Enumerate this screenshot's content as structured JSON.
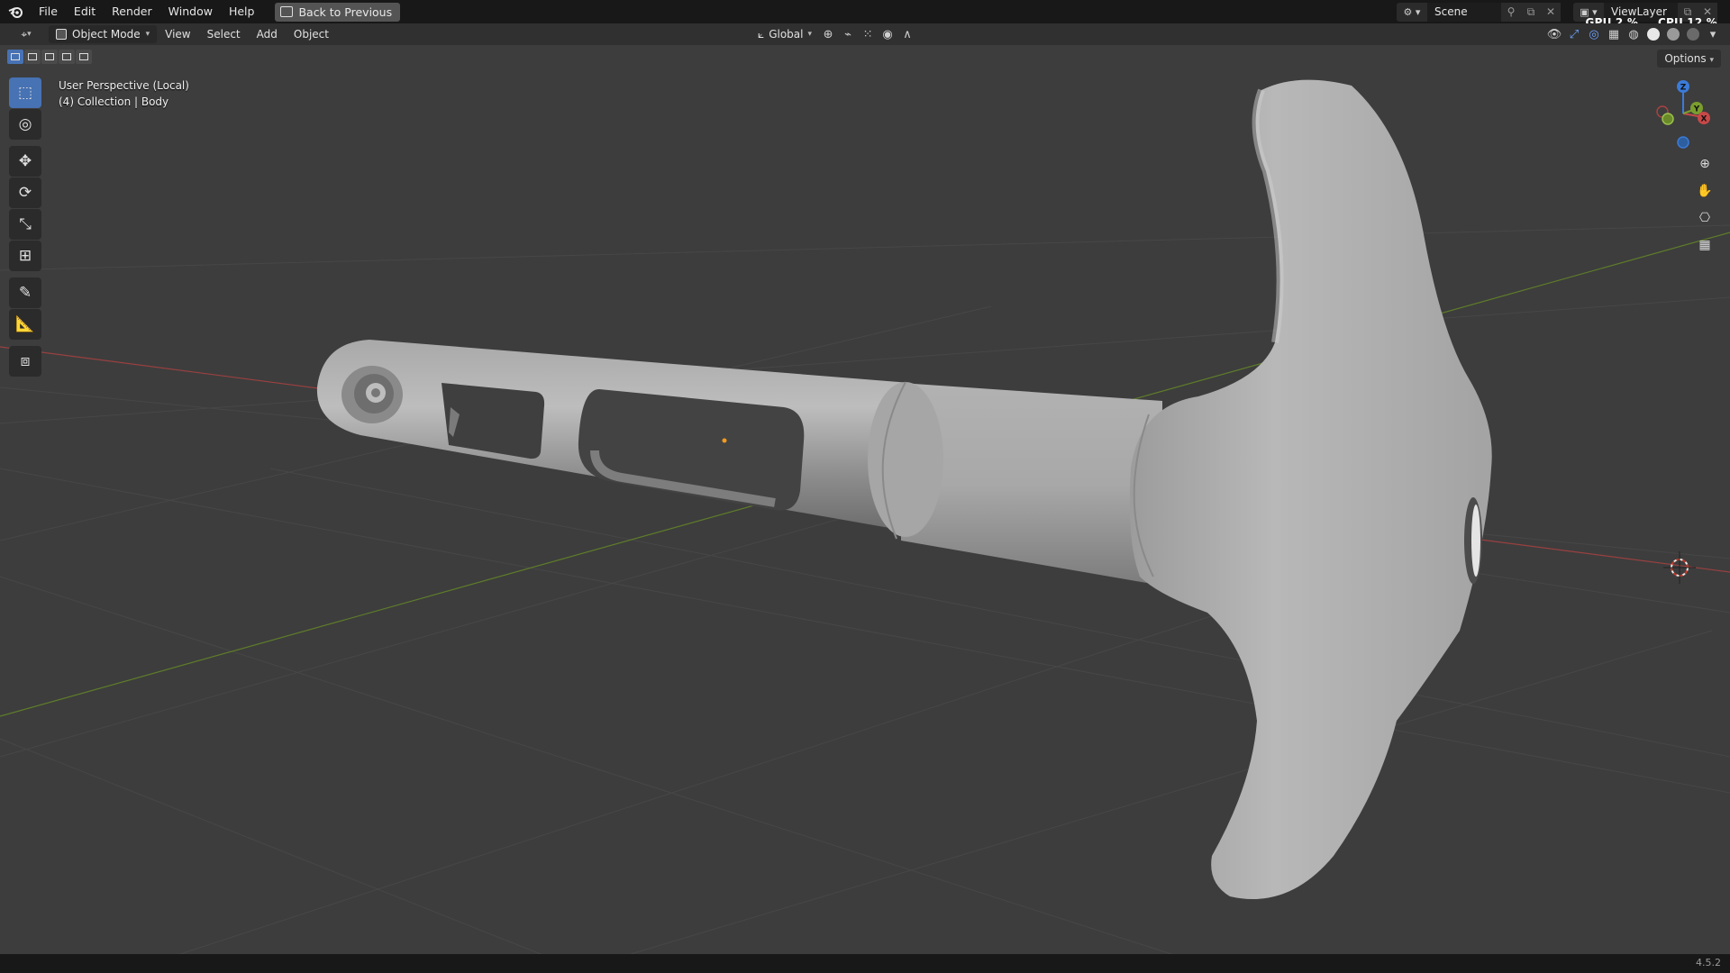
{
  "menubar": {
    "items": [
      "File",
      "Edit",
      "Render",
      "Window",
      "Help"
    ],
    "back_button": "Back to Previous",
    "scene": "Scene",
    "view_layer": "ViewLayer",
    "gpu_stat": "GPU   2 %",
    "cpu_stat": "CPU  12 %"
  },
  "header": {
    "mode": "Object Mode",
    "menus": [
      "View",
      "Select",
      "Add",
      "Object"
    ],
    "orientation": "Global",
    "options": "Options"
  },
  "viewport": {
    "perspective": "User Perspective (Local)",
    "collection": "(4) Collection | Body",
    "gizmo_axes": [
      "Z",
      "Y",
      "X"
    ]
  },
  "statusbar": {
    "version": "4.5.2"
  },
  "colors": {
    "accent": "#4772b3",
    "x_axis": "#b84a4a",
    "y_axis": "#6e8f2e",
    "z_axis": "#3b7bd9"
  },
  "icons": {
    "toolbar": [
      "select-box-icon",
      "cursor-icon",
      "move-icon",
      "rotate-icon",
      "scale-icon",
      "transform-icon",
      "annotate-icon",
      "measure-icon",
      "add-cube-icon"
    ],
    "nav": [
      "zoom-icon",
      "hand-pan-icon",
      "camera-icon",
      "grid-icon"
    ]
  }
}
